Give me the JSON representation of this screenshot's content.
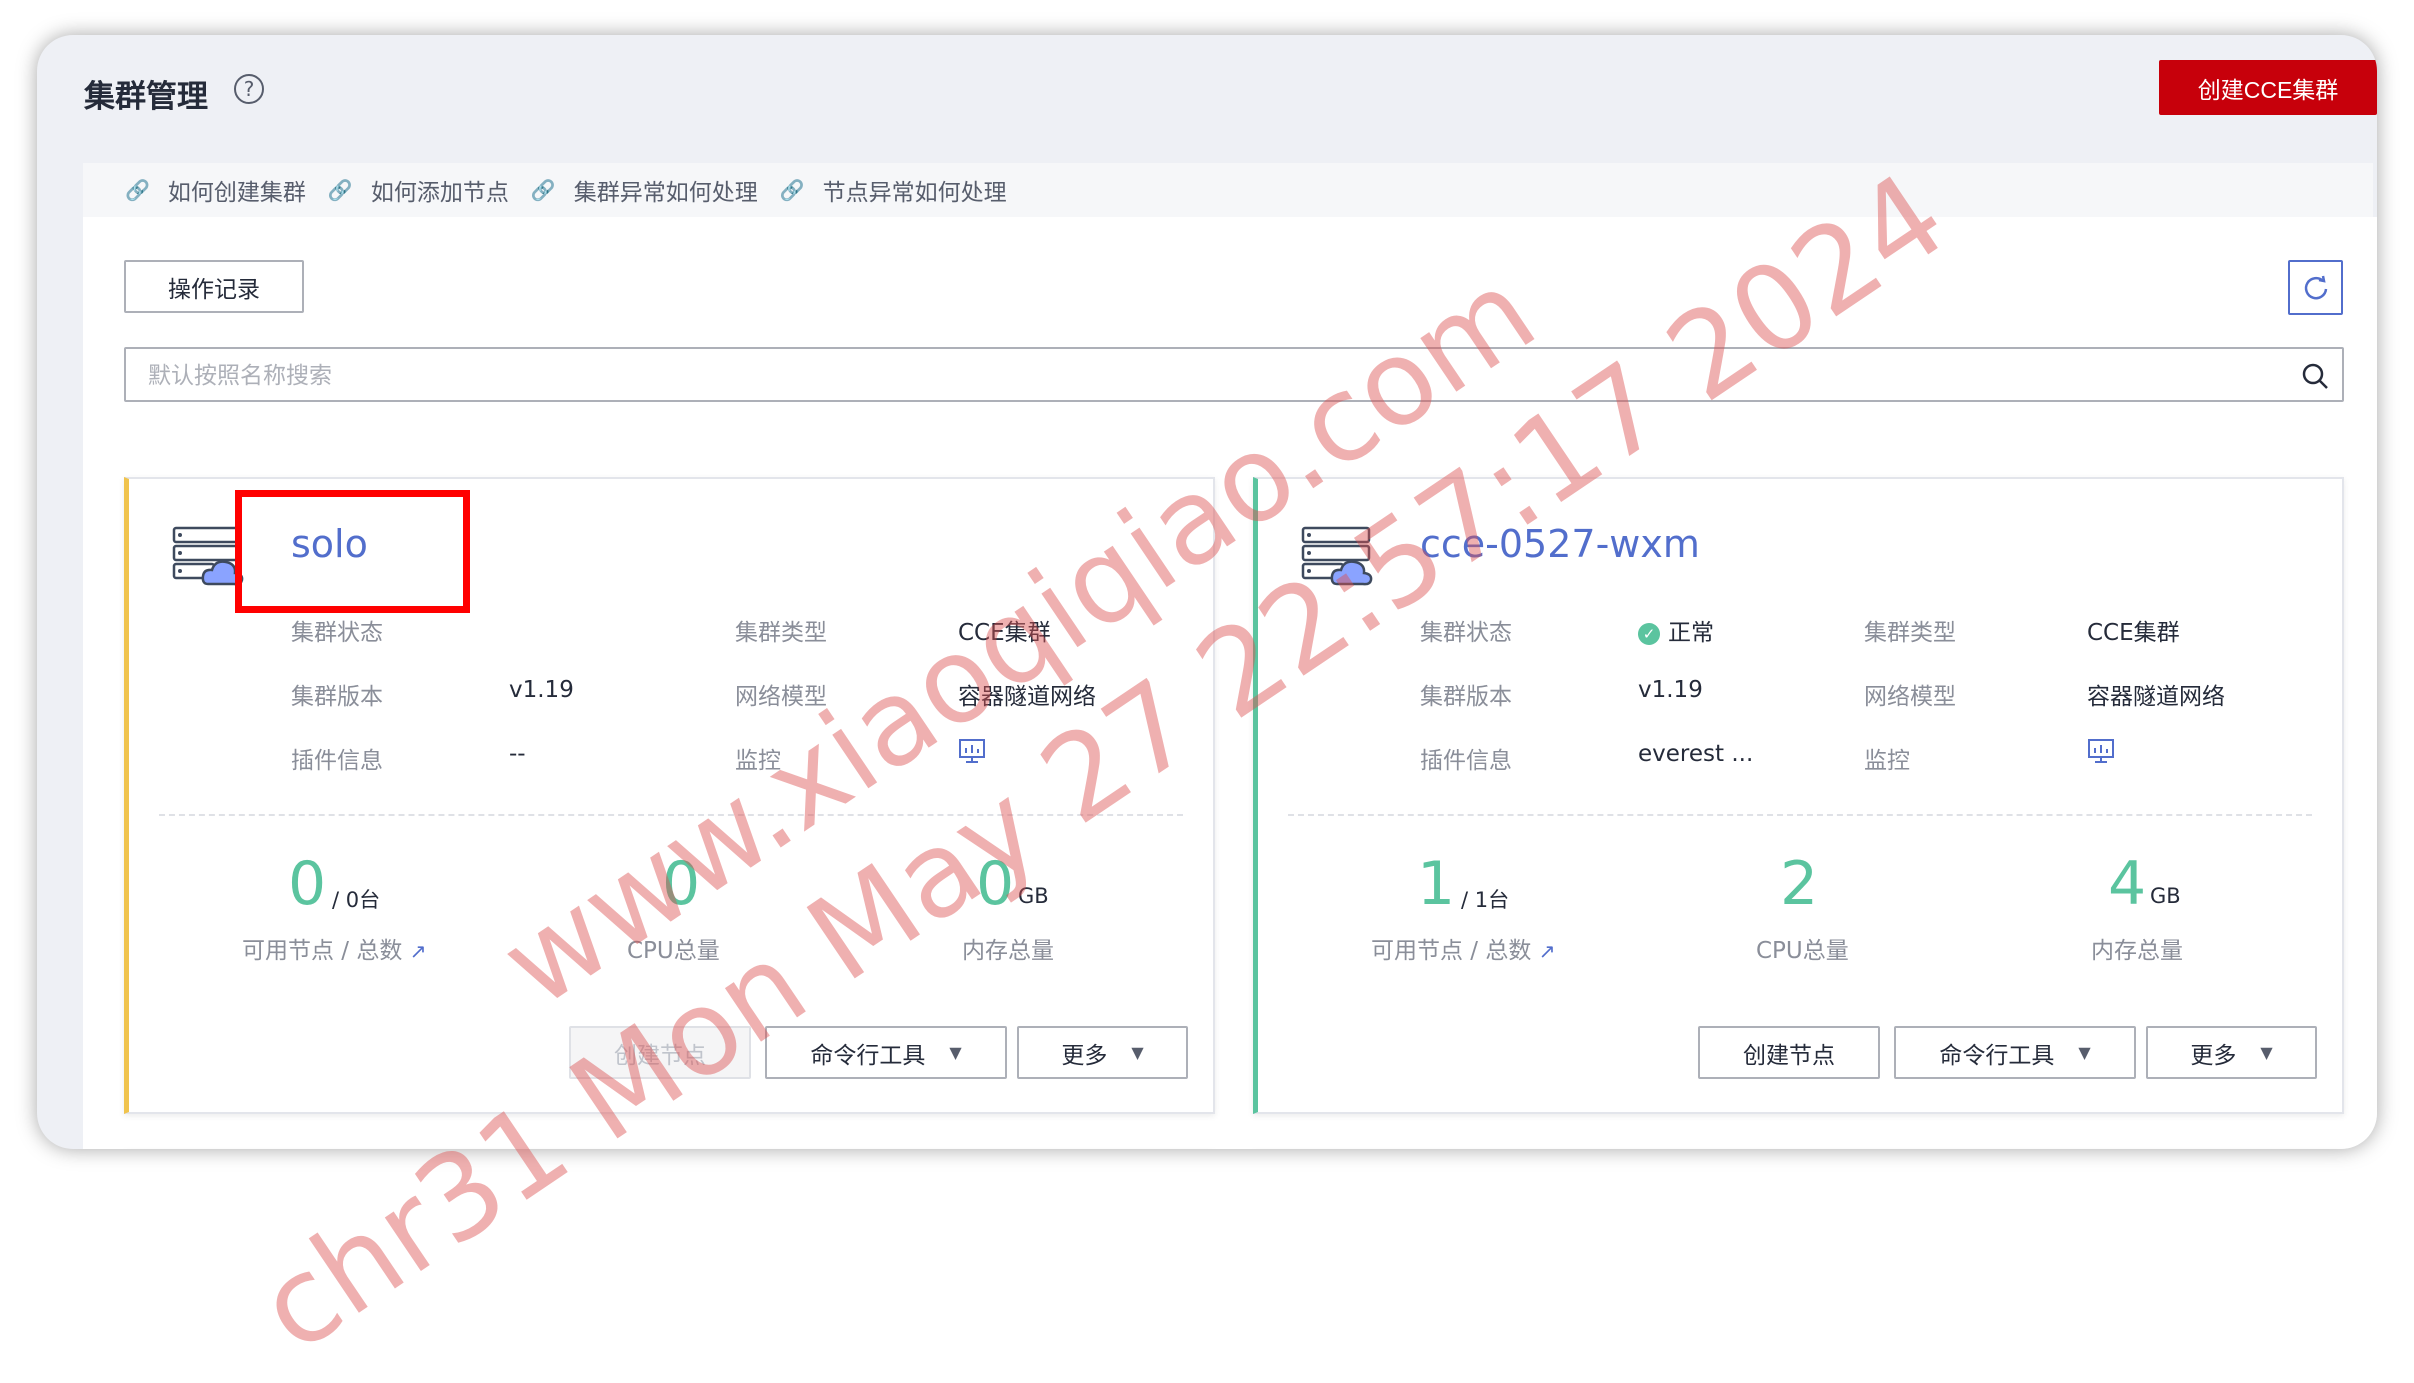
{
  "header": {
    "title": "集群管理",
    "help_symbol": "?",
    "create_button": "创建CCE集群"
  },
  "help_links": [
    {
      "label": "如何创建集群"
    },
    {
      "label": "如何添加节点"
    },
    {
      "label": "集群异常如何处理"
    },
    {
      "label": "节点异常如何处理"
    }
  ],
  "toolbar": {
    "op_record_label": "操作记录",
    "search_placeholder": "默认按照名称搜索"
  },
  "clusters": [
    {
      "name": "solo",
      "labels": {
        "status": "集群状态",
        "type": "集群类型",
        "version": "集群版本",
        "network": "网络模型",
        "plugins": "插件信息",
        "monitor": "监控"
      },
      "status": "",
      "type": "CCE集群",
      "version": "v1.19",
      "network": "容器隧道网络",
      "plugins": "--",
      "nodes_available": "0",
      "nodes_total": "/ 0台",
      "nodes_label": "可用节点 / 总数",
      "cpu": "0",
      "cpu_label": "CPU总量",
      "mem": "0",
      "mem_unit": "GB",
      "mem_label": "内存总量",
      "btn_create_node": "创建节点",
      "btn_cli": "命令行工具",
      "btn_more": "更多"
    },
    {
      "name": "cce-0527-wxm",
      "labels": {
        "status": "集群状态",
        "type": "集群类型",
        "version": "集群版本",
        "network": "网络模型",
        "plugins": "插件信息",
        "monitor": "监控"
      },
      "status": "正常",
      "type": "CCE集群",
      "version": "v1.19",
      "network": "容器隧道网络",
      "plugins": "everest ...",
      "nodes_available": "1",
      "nodes_total": "/ 1台",
      "nodes_label": "可用节点 / 总数",
      "cpu": "2",
      "cpu_label": "CPU总量",
      "mem": "4",
      "mem_unit": "GB",
      "mem_label": "内存总量",
      "btn_create_node": "创建节点",
      "btn_cli": "命令行工具",
      "btn_more": "更多"
    }
  ],
  "watermark": {
    "line1": "www.xiaoqiqiao.com",
    "line2": "chr31 Mon May 27 22:57:17 2024"
  },
  "colors": {
    "accent": "#526ecc",
    "brand_red": "#c7000b",
    "success": "#5bc49f",
    "warning_border": "#f0c34d"
  }
}
